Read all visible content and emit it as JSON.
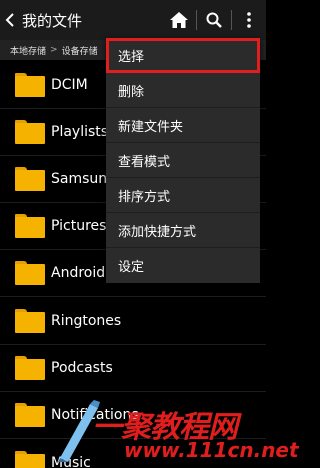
{
  "appbar": {
    "title": "我的文件",
    "icons": [
      "chevron-left-icon",
      "home-icon",
      "search-icon",
      "more-vert-icon"
    ]
  },
  "breadcrumb": {
    "root": "本地存储",
    "current": "设备存储"
  },
  "folders": [
    {
      "name": "DCIM"
    },
    {
      "name": "Playlists"
    },
    {
      "name": "Samsung"
    },
    {
      "name": "Pictures"
    },
    {
      "name": "Android"
    },
    {
      "name": "Ringtones"
    },
    {
      "name": "Podcasts"
    },
    {
      "name": "Notifications"
    },
    {
      "name": "Music"
    }
  ],
  "menu": {
    "items": [
      "选择",
      "删除",
      "新建文件夹",
      "查看模式",
      "排序方式",
      "添加快捷方式",
      "设定"
    ],
    "selected_index": 0
  },
  "watermark": {
    "text": "一聚教程网",
    "url": "www.111cn.net"
  },
  "colors": {
    "folder": "#f5b300",
    "highlight": "#e01e1e",
    "menu_bg": "#2b2b2b"
  }
}
